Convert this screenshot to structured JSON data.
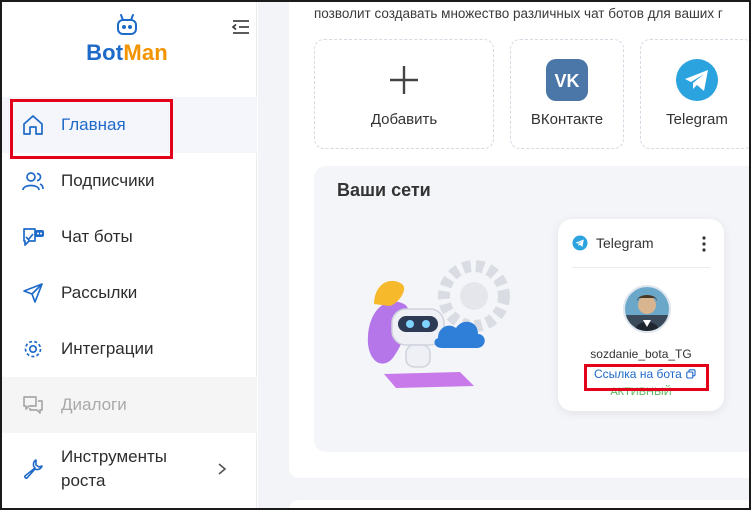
{
  "logo": {
    "part1": "Bot",
    "part2": "Man"
  },
  "sidebar": {
    "items": [
      {
        "label": "Главная",
        "icon": "home-icon"
      },
      {
        "label": "Подписчики",
        "icon": "users-icon"
      },
      {
        "label": "Чат боты",
        "icon": "chatbot-icon"
      },
      {
        "label": "Рассылки",
        "icon": "send-icon"
      },
      {
        "label": "Интеграции",
        "icon": "gear-icon"
      },
      {
        "label": "Диалоги",
        "icon": "dialogs-icon"
      },
      {
        "label": "Инструменты роста",
        "icon": "wrench-icon"
      }
    ]
  },
  "main": {
    "intro": "позволит создавать множество различных чат ботов для ваших г",
    "tiles": [
      {
        "label": "Добавить",
        "icon": "plus-icon"
      },
      {
        "label": "ВКонтакте",
        "icon": "vk-icon"
      },
      {
        "label": "Telegram",
        "icon": "telegram-icon"
      }
    ],
    "networks": {
      "title": "Ваши сети",
      "card": {
        "platform": "Telegram",
        "bot_name": "sozdanie_bota_TG",
        "link_label": "Ссылка на бота",
        "status": "АКТИВНЫЙ"
      }
    }
  },
  "colors": {
    "brand_blue": "#1e6ac9",
    "brand_orange": "#f29400",
    "highlight_red": "#e3001b",
    "vk_blue": "#4a76a8",
    "telegram_blue": "#2aa3df",
    "status_green": "#5cb85c"
  }
}
